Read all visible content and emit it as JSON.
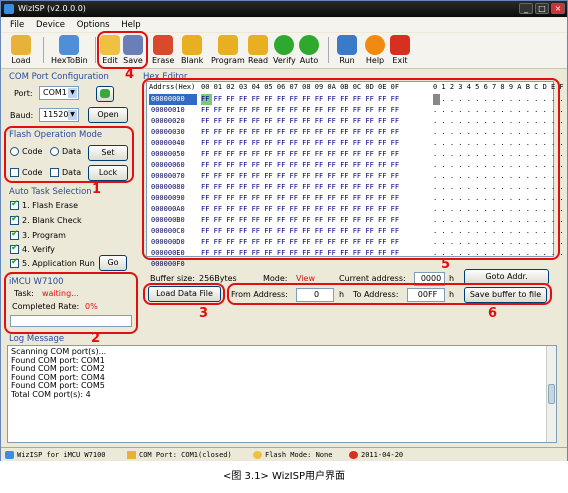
{
  "window": {
    "title": "WizISP (v2.0.0.0)"
  },
  "menu": [
    "File",
    "Device",
    "Options",
    "Help"
  ],
  "toolbar": [
    "Load",
    "HexToBin",
    "Edit",
    "Save",
    "Erase",
    "Blank",
    "Program",
    "Read",
    "Verify",
    "Auto",
    "Run",
    "Help",
    "Exit"
  ],
  "com_port": {
    "section_title": "COM Port Configuration",
    "port_label": "Port:",
    "port_value": "COM1",
    "baud_label": "Baud:",
    "baud_value": "115200",
    "open_label": "Open"
  },
  "flash_mode": {
    "section_title": "Flash Operation Mode",
    "radio_code": "Code",
    "radio_data": "Data",
    "set_label": "Set",
    "check_code": "Code",
    "check_data": "Data",
    "lock_label": "Lock"
  },
  "auto_task": {
    "section_title": "Auto Task Selection",
    "items": [
      "1. Flash Erase",
      "2. Blank Check",
      "3. Program",
      "4. Verify",
      "5. Application Run"
    ],
    "go_label": "Go"
  },
  "imcu": {
    "section_title": "iMCU W7100",
    "task_label": "Task:",
    "task_value": "waiting...",
    "rate_label": "Completed Rate:",
    "rate_value": "0%",
    "progress": 0
  },
  "hex_editor": {
    "section_title": "Hex Editor",
    "addr_header": "Addrss(Hex)",
    "columns_header": "00 01 02 03 04 05 06 07 08 09 0A 0B 0C 0D 0E 0F",
    "ascii_header": "0 1 2 3 4 5 6 7 8 9 A B C D E F",
    "addresses": [
      "00000000",
      "00000010",
      "00000020",
      "00000030",
      "00000040",
      "00000050",
      "00000060",
      "00000070",
      "00000080",
      "00000090",
      "000000A0",
      "000000B0",
      "000000C0",
      "000000D0",
      "000000E0",
      "000000F0"
    ],
    "row_bytes": "FF FF FF FF FF FF FF FF FF FF FF FF FF FF FF FF",
    "ascii_row": ". . . . . . . . . . . . . . . .",
    "ascii_first_row": "  . . . . . . . . . . . . . . ."
  },
  "buffer": {
    "size_label": "Buffer size:",
    "size_value": "256Bytes",
    "mode_label": "Mode:",
    "mode_value": "View",
    "current_label": "Current address:",
    "current_value": "0000",
    "goto_label": "Goto Addr.",
    "load_label": "Load Data File",
    "from_label": "From Address:",
    "from_value": "0",
    "to_label": "To Address:",
    "to_value": "00FF",
    "h": "h",
    "save_label": "Save buffer to file"
  },
  "log": {
    "section_title": "Log Message",
    "lines": [
      "Scanning COM port(s)...",
      "Found COM port: COM1",
      "Found COM port: COM2",
      "Found COM port: COM4",
      "Found COM port: COM5",
      "Total COM port(s): 4"
    ]
  },
  "statusbar": {
    "app": "WizISP for iMCU W7100",
    "com": "COM Port: COM1(closed)",
    "flash": "Flash Mode: None",
    "date": "2011-04-20"
  },
  "annotations": [
    "1",
    "2",
    "3",
    "4",
    "5",
    "6"
  ],
  "caption": "<图 3.1> WizISP用户界面",
  "colors": {
    "accent_red": "#e01010",
    "title_bg": "#0b0b0b",
    "section_blue": "#2a4b9c",
    "hex_blue": "#000080"
  }
}
